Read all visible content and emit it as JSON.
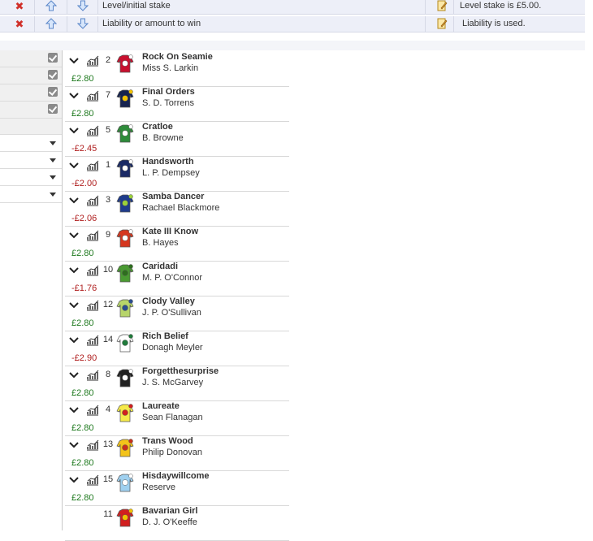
{
  "rules": [
    {
      "text": "Level/initial stake",
      "note": "Level stake is £5.00."
    },
    {
      "text": "Liability or amount to win",
      "note": "Liability is used."
    }
  ],
  "filters": {
    "checkboxes": 4,
    "dropdowns": 4
  },
  "colors": {
    "positive": "#1f7a1f",
    "negative": "#b02020"
  },
  "runners": [
    {
      "num": "2",
      "name": "Rock On Seamie",
      "jockey": "Miss S. Larkin",
      "pnl": "£2.80",
      "sign": "pos",
      "silk": [
        "#c8102e",
        "#ffffff"
      ]
    },
    {
      "num": "7",
      "name": "Final Orders",
      "jockey": "S. D. Torrens",
      "pnl": "£2.80",
      "sign": "pos",
      "silk": [
        "#16234f",
        "#f2c200"
      ]
    },
    {
      "num": "5",
      "name": "Cratloe",
      "jockey": "B. Browne",
      "pnl": "-£2.45",
      "sign": "neg",
      "silk": [
        "#2e8b3a",
        "#ffffff"
      ]
    },
    {
      "num": "1",
      "name": "Handsworth",
      "jockey": "L. P. Dempsey",
      "pnl": "-£2.00",
      "sign": "neg",
      "silk": [
        "#1a2a66",
        "#ffffff"
      ]
    },
    {
      "num": "3",
      "name": "Samba Dancer",
      "jockey": "Rachael Blackmore",
      "pnl": "-£2.06",
      "sign": "neg",
      "silk": [
        "#1f3c8c",
        "#9bd13a"
      ]
    },
    {
      "num": "9",
      "name": "Kate III Know",
      "jockey": "B. Hayes",
      "pnl": "£2.80",
      "sign": "pos",
      "silk": [
        "#d5371f",
        "#ffffff"
      ]
    },
    {
      "num": "10",
      "name": "Caridadi",
      "jockey": "M. P. O'Connor",
      "pnl": "-£1.76",
      "sign": "neg",
      "silk": [
        "#4a9a32",
        "#2e6e1e"
      ]
    },
    {
      "num": "12",
      "name": "Clody Valley",
      "jockey": "J. P. O'Sullivan",
      "pnl": "£2.80",
      "sign": "pos",
      "silk": [
        "#b7d56a",
        "#2a4d8f"
      ]
    },
    {
      "num": "14",
      "name": "Rich Belief",
      "jockey": "Donagh Meyler",
      "pnl": "-£2.90",
      "sign": "neg",
      "silk": [
        "#ffffff",
        "#1f7a3a"
      ]
    },
    {
      "num": "8",
      "name": "Forgetthesurprise",
      "jockey": "J. S. McGarvey",
      "pnl": "£2.80",
      "sign": "pos",
      "silk": [
        "#222222",
        "#ffffff"
      ]
    },
    {
      "num": "4",
      "name": "Laureate",
      "jockey": "Sean Flanagan",
      "pnl": "£2.80",
      "sign": "pos",
      "silk": [
        "#f5e94a",
        "#d11f1f"
      ]
    },
    {
      "num": "13",
      "name": "Trans Wood",
      "jockey": "Philip Donovan",
      "pnl": "£2.80",
      "sign": "pos",
      "silk": [
        "#f3c31a",
        "#c8301c"
      ]
    },
    {
      "num": "15",
      "name": "Hisdaywillcome",
      "jockey": "Reserve",
      "pnl": "£2.80",
      "sign": "pos",
      "silk": [
        "#9fd0ef",
        "#ffffff"
      ]
    },
    {
      "num": "11",
      "name": "Bavarian Girl",
      "jockey": "D. J. O'Keeffe",
      "pnl": "",
      "sign": "pos",
      "silk": [
        "#d11f1f",
        "#f2c200"
      ]
    }
  ]
}
